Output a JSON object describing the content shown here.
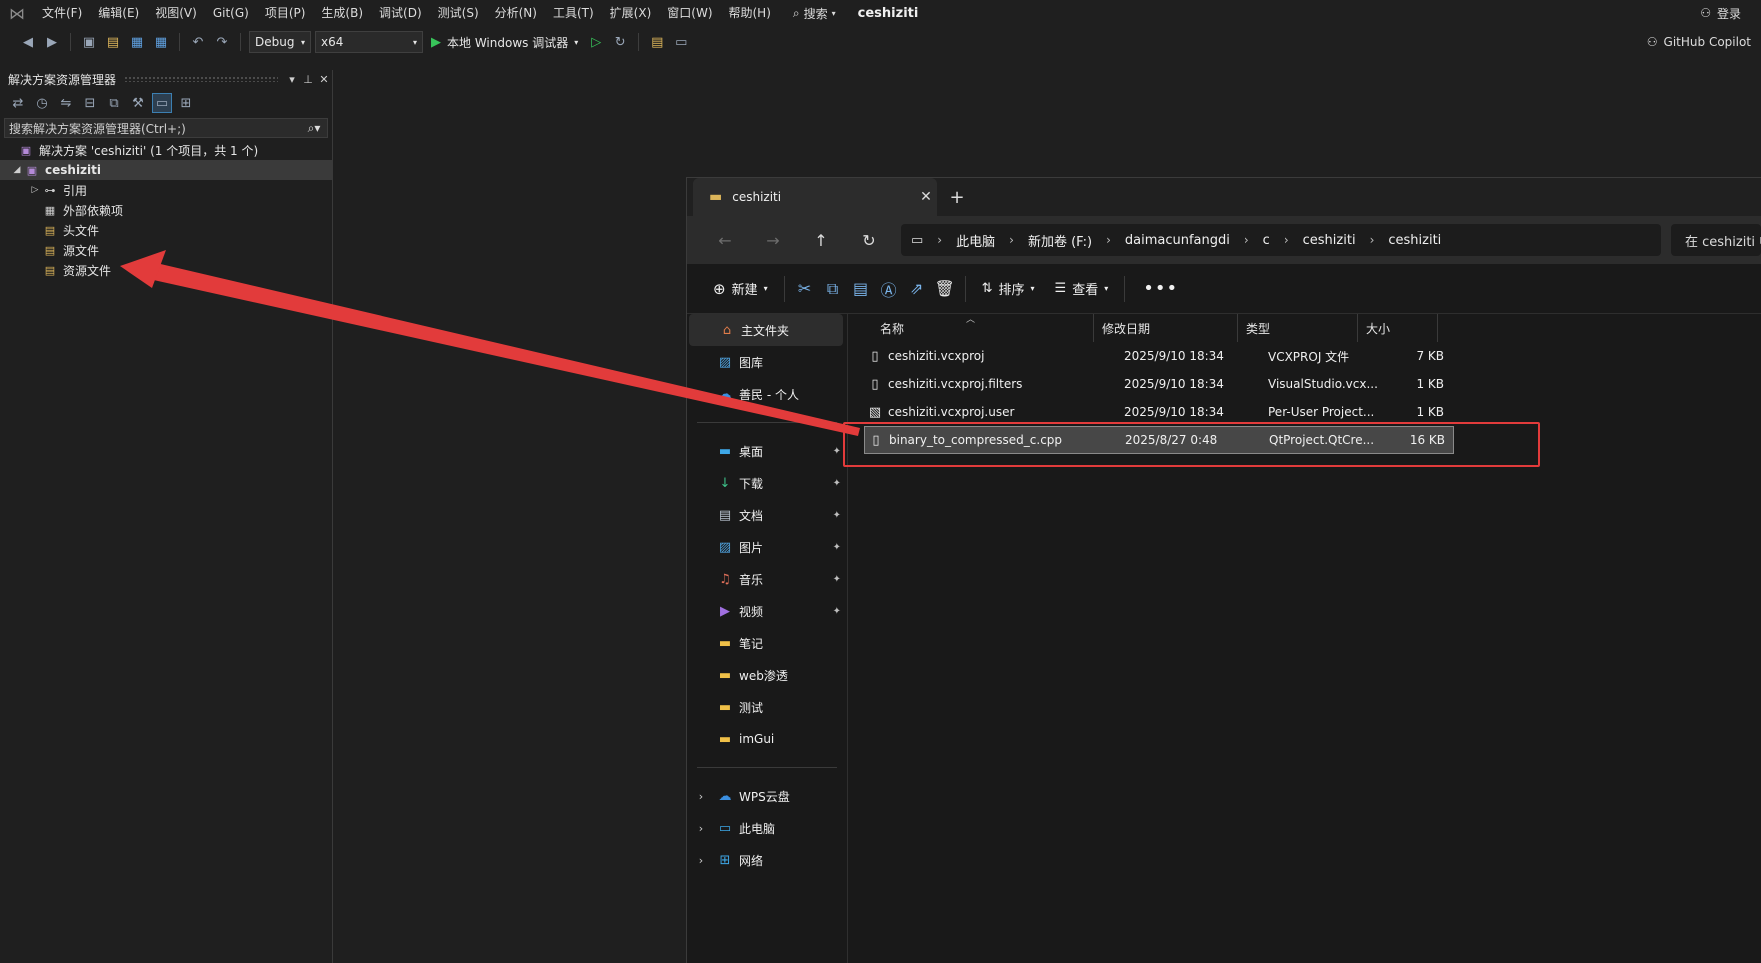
{
  "menubar": {
    "items": [
      "文件(F)",
      "编辑(E)",
      "视图(V)",
      "Git(G)",
      "项目(P)",
      "生成(B)",
      "调试(D)",
      "测试(S)",
      "分析(N)",
      "工具(T)",
      "扩展(X)",
      "窗口(W)",
      "帮助(H)"
    ],
    "search_label": "搜索",
    "solution_name": "ceshiziti",
    "login_label": "登录"
  },
  "toolbar": {
    "configuration": "Debug",
    "platform": "x64",
    "run_label": "本地 Windows 调试器",
    "copilot_label": "GitHub Copilot"
  },
  "solution_explorer": {
    "title": "解决方案资源管理器",
    "search_placeholder": "搜索解决方案资源管理器(Ctrl+;)",
    "solution_row": "解决方案 'ceshiziti' (1 个项目，共 1 个)",
    "project": "ceshiziti",
    "items": [
      "引用",
      "外部依赖项",
      "头文件",
      "源文件",
      "资源文件"
    ]
  },
  "explorer": {
    "tab_title": "ceshiziti",
    "breadcrumb": [
      "此电脑",
      "新加卷 (F:)",
      "daimacunfangdi",
      "c",
      "ceshiziti",
      "ceshiziti"
    ],
    "search_placeholder": "在 ceshiziti 中搜索",
    "commands": {
      "new": "新建",
      "sort": "排序",
      "view": "查看"
    },
    "nav": {
      "home": "主文件夹",
      "gallery": "图库",
      "onedrive": "善民 - 个人",
      "pinned": [
        "桌面",
        "下载",
        "文档",
        "图片",
        "音乐",
        "视频"
      ],
      "folders": [
        "笔记",
        "web渗透",
        "测试",
        "imGui"
      ],
      "bottom": [
        "WPS云盘",
        "此电脑",
        "网络"
      ]
    },
    "columns": [
      "名称",
      "修改日期",
      "类型",
      "大小"
    ],
    "files": [
      {
        "name": "ceshiziti.vcxproj",
        "date": "2025/9/10 18:34",
        "type": "VCXPROJ 文件",
        "size": "7 KB"
      },
      {
        "name": "ceshiziti.vcxproj.filters",
        "date": "2025/9/10 18:34",
        "type": "VisualStudio.vcx...",
        "size": "1 KB"
      },
      {
        "name": "ceshiziti.vcxproj.user",
        "date": "2025/9/10 18:34",
        "type": "Per-User Project...",
        "size": "1 KB"
      },
      {
        "name": "binary_to_compressed_c.cpp",
        "date": "2025/8/27 0:48",
        "type": "QtProject.QtCre...",
        "size": "16 KB"
      }
    ]
  },
  "colors": {
    "annotation_red": "#e23b3b",
    "run_green": "#38c45a",
    "folder_yellow": "#dcb55a"
  }
}
